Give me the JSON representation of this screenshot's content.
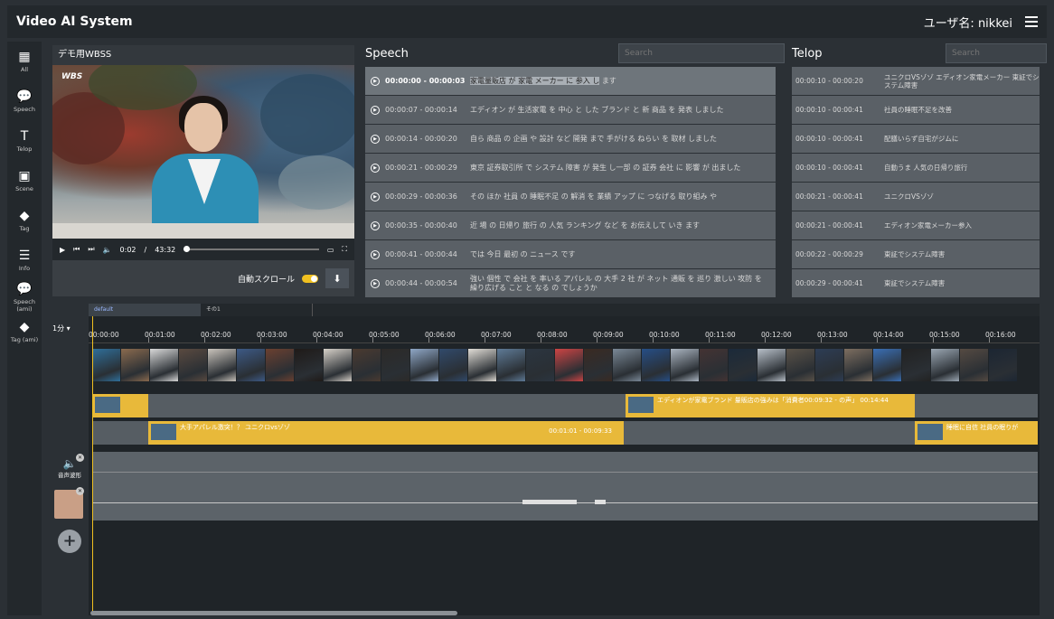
{
  "app": {
    "title": "Video AI System",
    "user_label": "ユーザ名: nikkei"
  },
  "sidebar": {
    "items": [
      {
        "label": "All",
        "icon": "film-icon"
      },
      {
        "label": "Speech",
        "icon": "speech-bubble-icon"
      },
      {
        "label": "Telop",
        "icon": "text-icon"
      },
      {
        "label": "Scene",
        "icon": "image-icon"
      },
      {
        "label": "Tag",
        "icon": "tag-icon"
      },
      {
        "label": "Info",
        "icon": "list-icon"
      },
      {
        "label": "Speech (ami)",
        "icon": "speech-bubble-icon"
      },
      {
        "label": "Tag (ami)",
        "icon": "tag-icon"
      }
    ]
  },
  "video": {
    "title": "デモ用WBSS",
    "logo": "WBS",
    "current_time": "0:02",
    "duration": "43:32",
    "autoscroll_label": "自動スクロール",
    "autoscroll_on": true
  },
  "speech": {
    "title": "Speech",
    "search_placeholder": "Search",
    "rows": [
      {
        "time": "00:00:00 - 00:00:03",
        "text_hl": "家電量販店 が 家電 メーカー に 参入 し",
        "text": "ます"
      },
      {
        "time": "00:00:07 - 00:00:14",
        "text_hl": "",
        "text": "エディオン が 生活家電 を 中心 と した ブランド と 新 商品 を 発表 しました"
      },
      {
        "time": "00:00:14 - 00:00:20",
        "text_hl": "",
        "text": "自ら 商品 の 企画 や 設計 など 開発 まで 手がける ねらい を 取材 しました"
      },
      {
        "time": "00:00:21 - 00:00:29",
        "text_hl": "",
        "text": "東京 証券取引所 で システム 障害 が 発生 し一部 の 証券 会社 に 影響 が 出ました"
      },
      {
        "time": "00:00:29 - 00:00:36",
        "text_hl": "",
        "text": "その ほか 社員 の 睡眠不足 の 解消 を 業績 アップ に つなげる 取り組み や"
      },
      {
        "time": "00:00:35 - 00:00:40",
        "text_hl": "",
        "text": "近 場 の 日帰り 旅行 の 人気 ランキング など を お伝えして いき ます"
      },
      {
        "time": "00:00:41 - 00:00:44",
        "text_hl": "",
        "text": "では 今日 最初 の ニュース です"
      },
      {
        "time": "00:00:44 - 00:00:54",
        "text_hl": "",
        "text": "強い 個性 で 会社 を 率いる アパレル の 大手 2 社 が ネット 通販 を 巡り 激しい 攻防 を 繰り広げる こと と なる の でしょうか"
      }
    ]
  },
  "telop": {
    "title": "Telop",
    "search_placeholder": "Search",
    "rows": [
      {
        "time": "00:00:10 - 00:00:20",
        "text": "ユニクロVSゾゾ エディオン家電メーカー 東証でシステム障害"
      },
      {
        "time": "00:00:10 - 00:00:41",
        "text": "社員の睡眠不足を改善"
      },
      {
        "time": "00:00:10 - 00:00:41",
        "text": "配膳いらず自宅がジムに"
      },
      {
        "time": "00:00:10 - 00:00:41",
        "text": "自動うま 人気の日帰り旅行"
      },
      {
        "time": "00:00:21 - 00:00:41",
        "text": "ユニクロVSゾゾ"
      },
      {
        "time": "00:00:21 - 00:00:41",
        "text": "エディオン家電メーカー参入"
      },
      {
        "time": "00:00:22 - 00:00:29",
        "text": "東証でシステム障害"
      },
      {
        "time": "00:00:29 - 00:00:41",
        "text": "東証でシステム障害"
      }
    ]
  },
  "timeline": {
    "tabs": [
      "default",
      "その1"
    ],
    "zoom": "1分",
    "ticks": [
      "00:00:00",
      "00:01:00",
      "00:02:00",
      "00:03:00",
      "00:04:00",
      "00:05:00",
      "00:06:00",
      "00:07:00",
      "00:08:00",
      "00:09:00",
      "00:10:00",
      "00:11:00",
      "00:12:00",
      "00:13:00",
      "00:14:00",
      "00:15:00",
      "00:16:00"
    ],
    "clip_edion": "エディオンが家電ブランド 量販店の強みは「消費者00:09:32 - の声」 00:14:44",
    "clip_uniqlo": "大手アパレル激突！？ ユニクロvsゾゾ",
    "clip_uniqlo_time": "00:01:01 - 00:09:33",
    "clip_tail": "睡眠に自信 社員の眠りが",
    "audio_label": "音声波形"
  }
}
